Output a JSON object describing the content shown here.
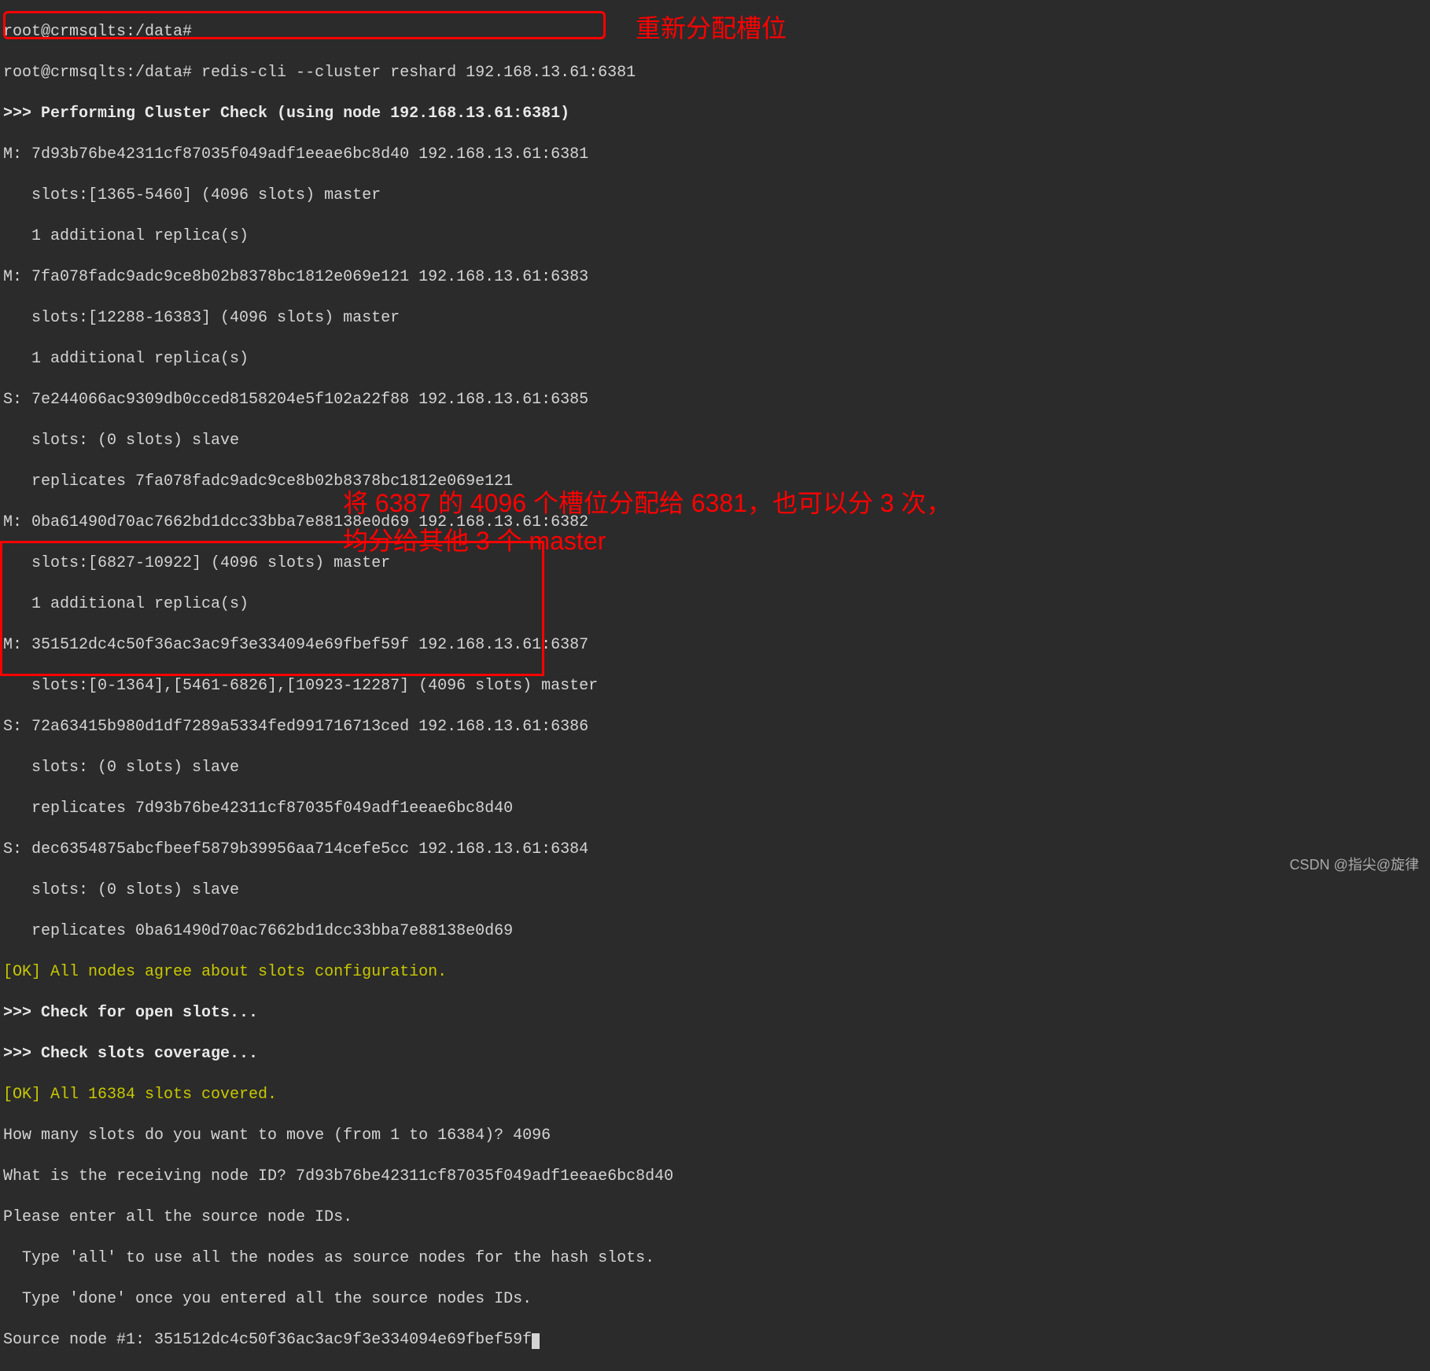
{
  "prompt0": "root@crmsqlts:/data#",
  "command": "root@crmsqlts:/data# redis-cli --cluster reshard 192.168.13.61:6381",
  "header": ">>> Performing Cluster Check (using node 192.168.13.61:6381)",
  "nodes": [
    "M: 7d93b76be42311cf87035f049adf1eeae6bc8d40 192.168.13.61:6381",
    "   slots:[1365-5460] (4096 slots) master",
    "   1 additional replica(s)",
    "M: 7fa078fadc9adc9ce8b02b8378bc1812e069e121 192.168.13.61:6383",
    "   slots:[12288-16383] (4096 slots) master",
    "   1 additional replica(s)",
    "S: 7e244066ac9309db0cced8158204e5f102a22f88 192.168.13.61:6385",
    "   slots: (0 slots) slave",
    "   replicates 7fa078fadc9adc9ce8b02b8378bc1812e069e121",
    "M: 0ba61490d70ac7662bd1dcc33bba7e88138e0d69 192.168.13.61:6382",
    "   slots:[6827-10922] (4096 slots) master",
    "   1 additional replica(s)",
    "M: 351512dc4c50f36ac3ac9f3e334094e69fbef59f 192.168.13.61:6387",
    "   slots:[0-1364],[5461-6826],[10923-12287] (4096 slots) master",
    "S: 72a63415b980d1df7289a5334fed991716713ced 192.168.13.61:6386",
    "   slots: (0 slots) slave",
    "   replicates 7d93b76be42311cf87035f049adf1eeae6bc8d40",
    "S: dec6354875abcfbeef5879b39956aa714cefe5cc 192.168.13.61:6384",
    "   slots: (0 slots) slave",
    "   replicates 0ba61490d70ac7662bd1dcc33bba7e88138e0d69"
  ],
  "ok1": "[OK] All nodes agree about slots configuration.",
  "check1": ">>> Check for open slots...",
  "check2": ">>> Check slots coverage...",
  "ok2": "[OK] All 16384 slots covered.",
  "q1": "How many slots do you want to move (from 1 to 16384)? 4096",
  "q2": "What is the receiving node ID? 7d93b76be42311cf87035f049adf1eeae6bc8d40",
  "q3": "Please enter all the source node IDs.",
  "q4": "  Type 'all' to use all the nodes as source nodes for the hash slots.",
  "q5": "  Type 'done' once you entered all the source nodes IDs.",
  "q6": "Source node #1: 351512dc4c50f36ac3ac9f3e334094e69fbef59f",
  "annotation1": "重新分配槽位",
  "annotation2_l1": "将 6387 的 4096 个槽位分配给 6381，也可以分 3 次，",
  "annotation2_l2": "均分给其他 3 个 master",
  "watermark": "CSDN @指尖@旋律"
}
